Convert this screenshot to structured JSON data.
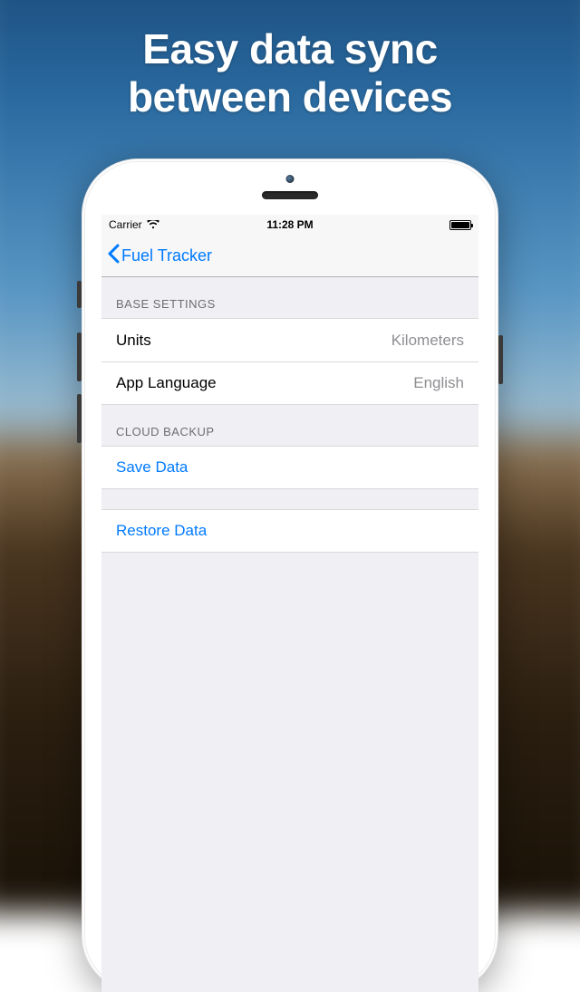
{
  "marketing": {
    "line1": "Easy data sync",
    "line2": "between devices"
  },
  "status_bar": {
    "carrier": "Carrier",
    "time": "11:28 PM"
  },
  "nav": {
    "back_label": "Fuel Tracker"
  },
  "sections": {
    "base": {
      "header": "BASE SETTINGS",
      "units_label": "Units",
      "units_value": "Kilometers",
      "lang_label": "App Language",
      "lang_value": "English"
    },
    "cloud": {
      "header": "CLOUD BACKUP",
      "save_label": "Save Data",
      "restore_label": "Restore Data"
    }
  },
  "colors": {
    "ios_blue": "#007aff",
    "group_bg": "#efeff4",
    "secondary_text": "#8e8e93"
  }
}
